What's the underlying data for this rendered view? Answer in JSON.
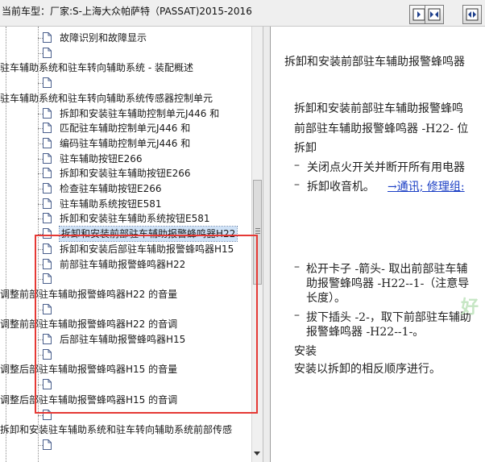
{
  "header": {
    "title": "当前车型：厂家:S-上海大众帕萨特（PASSAT)2015-2016",
    "buttons": [
      {
        "name": "show-panel-button",
        "icon": "panel-right-icon"
      },
      {
        "name": "collapse-panels-button",
        "icon": "arrows-inward-icon"
      },
      {
        "name": "expand-panels-button",
        "icon": "arrows-outward-icon"
      }
    ]
  },
  "tree": {
    "items": [
      {
        "label": "故障识别和故障显示",
        "level": 3
      },
      {
        "label": "",
        "level": 3
      },
      {
        "label": "驻车辅助系统和驻车转向辅助系统 - 装配概述",
        "level": 1
      },
      {
        "label": "",
        "level": 3
      },
      {
        "label": "驻车辅助系统和驻车转向辅助系统传感器控制单元",
        "level": 1
      },
      {
        "label": "拆卸和安装驻车辅助控制单元J446 和",
        "level": 3
      },
      {
        "label": "匹配驻车辅助控制单元J446 和",
        "level": 3
      },
      {
        "label": "编码驻车辅助控制单元J446 和",
        "level": 3
      },
      {
        "label": "驻车辅助按钮E266",
        "level": 3
      },
      {
        "label": "拆卸和安装驻车辅助按钮E266",
        "level": 3
      },
      {
        "label": "检查驻车辅助按钮E266",
        "level": 3
      },
      {
        "label": "驻车辅助系统按钮E581",
        "level": 3
      },
      {
        "label": "拆卸和安装驻车辅助系统按钮E581",
        "level": 3
      },
      {
        "label": "拆卸和安装前部驻车辅助报警蜂鸣器H22",
        "level": 3,
        "selected": true
      },
      {
        "label": "拆卸和安装后部驻车辅助报警蜂鸣器H15",
        "level": 3
      },
      {
        "label": "前部驻车辅助报警蜂鸣器H22",
        "level": 3
      },
      {
        "label": "",
        "level": 3
      },
      {
        "label": "调整前部驻车辅助报警蜂鸣器H22 的音量",
        "level": 1
      },
      {
        "label": "",
        "level": 3
      },
      {
        "label": "调整前部驻车辅助报警蜂鸣器H22 的音调",
        "level": 1
      },
      {
        "label": "后部驻车辅助报警蜂鸣器H15",
        "level": 3
      },
      {
        "label": "",
        "level": 3
      },
      {
        "label": "调整后部驻车辅助报警蜂鸣器H15 的音量",
        "level": 1
      },
      {
        "label": "",
        "level": 3
      },
      {
        "label": "调整后部驻车辅助报警蜂鸣器H15 的音调",
        "level": 1
      },
      {
        "label": "",
        "level": 3
      },
      {
        "label": "拆卸和安装驻车辅助系统和驻车转向辅助系统前部传感",
        "level": 1
      },
      {
        "label": "",
        "level": 3
      }
    ]
  },
  "content": {
    "heading": "拆卸和安装前部驻车辅助报警蜂鸣器",
    "l1": "拆卸和安装前部驻车辅助报警蜂鸣",
    "l2": "前部驻车辅助报警蜂鸣器 -H22- 位",
    "l3": "拆卸",
    "b1_mark": "–",
    "b1": "关闭点火开关并断开所有用电器",
    "b2_mark": "–",
    "b2": "拆卸收音机。",
    "b2_link": "→通讯; 修理组:",
    "b3_mark": "–",
    "b3a": "松开卡子 -箭头- 取出前部驻车辅",
    "b3b": "助报警蜂鸣器 -H22--1-（注意导",
    "b3c": "长度）。",
    "b4_mark": "–",
    "b4a": "拔下插头 -2-，取下前部驻车辅助",
    "b4b": "报警蜂鸣器 -H22--1-。",
    "l4": "安装",
    "l5": "安装以拆卸的相反顺序进行。",
    "watermark": "好"
  },
  "colors": {
    "highlight_box": "#e53935",
    "link": "#1a3ec4",
    "selection": "#cfe2f7"
  }
}
